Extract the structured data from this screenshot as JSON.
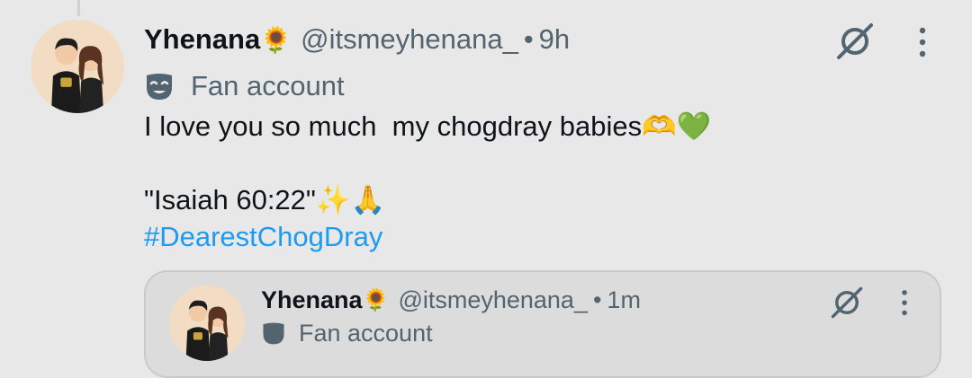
{
  "tweet": {
    "author_name": "Yhenana",
    "author_emoji": "🌻",
    "handle": "@itsmeyhenana_",
    "separator": "•",
    "time": "9h",
    "label_icon": "mask-icon",
    "label": "Fan account",
    "text_line1": "I love you so much  my chogdray babies🫶💚",
    "text_line2": "\"Isaiah 60:22\"✨🙏",
    "hashtag": "#DearestChogDray"
  },
  "quoted_tweet": {
    "author_name": "Yhenana",
    "author_emoji": "🌻",
    "handle": "@itsmeyhenana_",
    "separator": "•",
    "time": "1m",
    "label": "Fan account"
  },
  "icons": {
    "grok": "grok-icon",
    "more": "more-vertical-icon"
  },
  "colors": {
    "background": "#e8e8e8",
    "text": "#0f1419",
    "secondary": "#536471",
    "hashtag": "#1d9bf0"
  }
}
